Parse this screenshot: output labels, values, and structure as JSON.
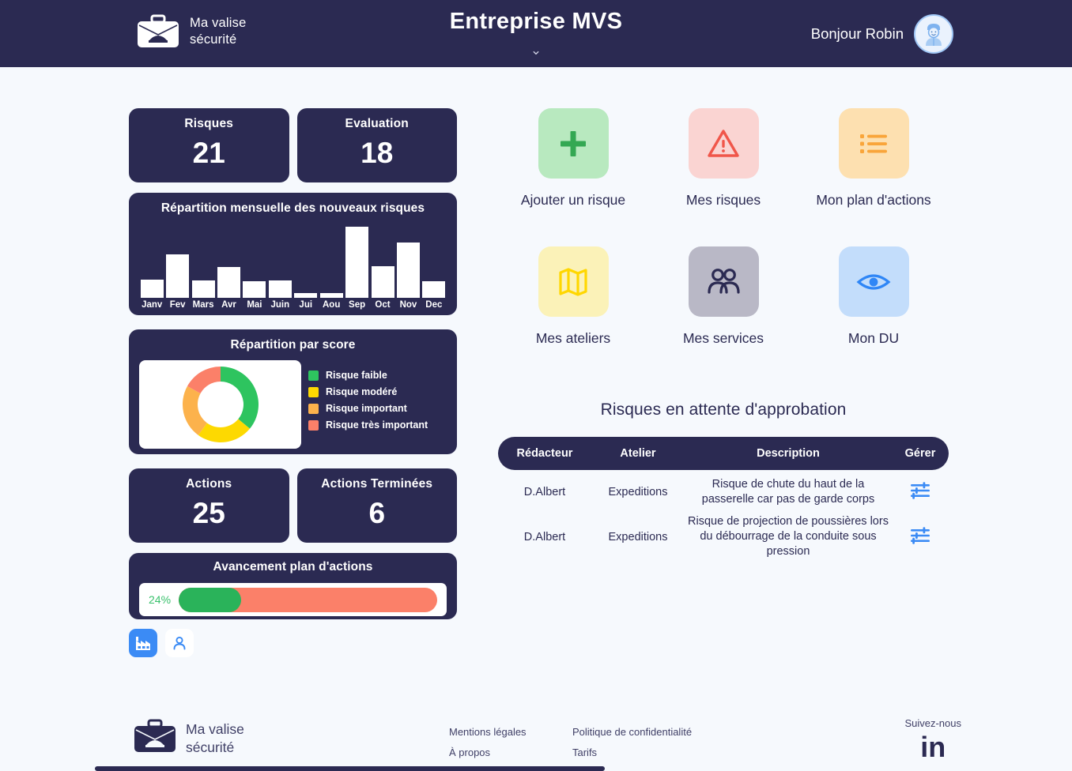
{
  "header": {
    "brand_name": "Ma valise\nsécurité",
    "brand_icon": "briefcase-icon",
    "title": "Entreprise MVS",
    "chevron": "⌄",
    "greeting": "Bonjour Robin",
    "avatar_icon": "user-avatar-icon"
  },
  "stats": {
    "risques": {
      "label": "Risques",
      "value": "21"
    },
    "evaluation": {
      "label": "Evaluation",
      "value": "18"
    },
    "actions": {
      "label": "Actions",
      "value": "25"
    },
    "actions_terminees": {
      "label": "Actions Terminées",
      "value": "6"
    }
  },
  "progress": {
    "title": "Avancement plan d'actions",
    "percent_label": "24%",
    "percent": 24,
    "fill_color": "#2ab35a",
    "track_color": "#fb8069"
  },
  "view_toggles": [
    {
      "name": "factory-icon",
      "active": true
    },
    {
      "name": "person-icon",
      "active": false
    }
  ],
  "tiles": [
    {
      "label": "Ajouter un risque",
      "icon": "plus-icon",
      "bg": "#b8e9bf",
      "fg": "#34a853"
    },
    {
      "label": "Mes risques",
      "icon": "warning-icon",
      "bg": "#fad4d2",
      "fg": "#f0564a"
    },
    {
      "label": "Mon plan d'actions",
      "icon": "list-icon",
      "bg": "#fde0b0",
      "fg": "#f9a53a"
    },
    {
      "label": "Mes ateliers",
      "icon": "map-icon",
      "bg": "#fbf2b8",
      "fg": "#ffd700"
    },
    {
      "label": "Mes services",
      "icon": "users-icon",
      "bg": "#b9b8c6",
      "fg": "#2b2a52"
    },
    {
      "label": "Mon DU",
      "icon": "eye-icon",
      "bg": "#c3ddfb",
      "fg": "#2f86f6"
    }
  ],
  "pending_table": {
    "title": "Risques en attente d'approbation",
    "columns": [
      "Rédacteur",
      "Atelier",
      "Description",
      "Gérer"
    ],
    "rows": [
      {
        "redacteur": "D.Albert",
        "atelier": "Expeditions",
        "description": "Risque de chute du haut de la passerelle car pas de garde corps",
        "action_icon": "sliders-icon"
      },
      {
        "redacteur": "D.Albert",
        "atelier": "Expeditions",
        "description": "Risque de projection de poussières lors du débourrage de la conduite sous pression",
        "action_icon": "sliders-icon"
      }
    ]
  },
  "footer": {
    "brand_name": "Ma valise\nsécurité",
    "brand_icon": "briefcase-icon",
    "links_col1": [
      "Mentions légales",
      "À propos"
    ],
    "links_col2": [
      "Politique de confidentialité",
      "Tarifs"
    ],
    "social_label": "Suivez-nous",
    "social_icon": "linkedin-icon",
    "social_glyph": "in"
  },
  "chart_data": [
    {
      "type": "bar",
      "title": "Répartition mensuelle des nouveaux risques",
      "categories": [
        "Janv",
        "Fev",
        "Mars",
        "Avr",
        "Mai",
        "Juin",
        "Jui",
        "Aou",
        "Sep",
        "Oct",
        "Nov",
        "Dec"
      ],
      "values": [
        25,
        60,
        24,
        42,
        23,
        24,
        6,
        6,
        98,
        43,
        76,
        23
      ],
      "xlabel": "",
      "ylabel": "",
      "ylim": [
        0,
        100
      ],
      "bar_color": "#ffffff",
      "background": "#2b2a52",
      "grid": false,
      "legend": "none"
    },
    {
      "type": "pie",
      "title": "Répartition par score",
      "donut": true,
      "labels": [
        "Risque faible",
        "Risque modéré",
        "Risque important",
        "Risque très important"
      ],
      "values": [
        36,
        24,
        23,
        17
      ],
      "colors": [
        "#2ec45f",
        "#fdd901",
        "#fcb24c",
        "#fb8069"
      ],
      "legend": "right",
      "background": "#ffffff"
    }
  ]
}
